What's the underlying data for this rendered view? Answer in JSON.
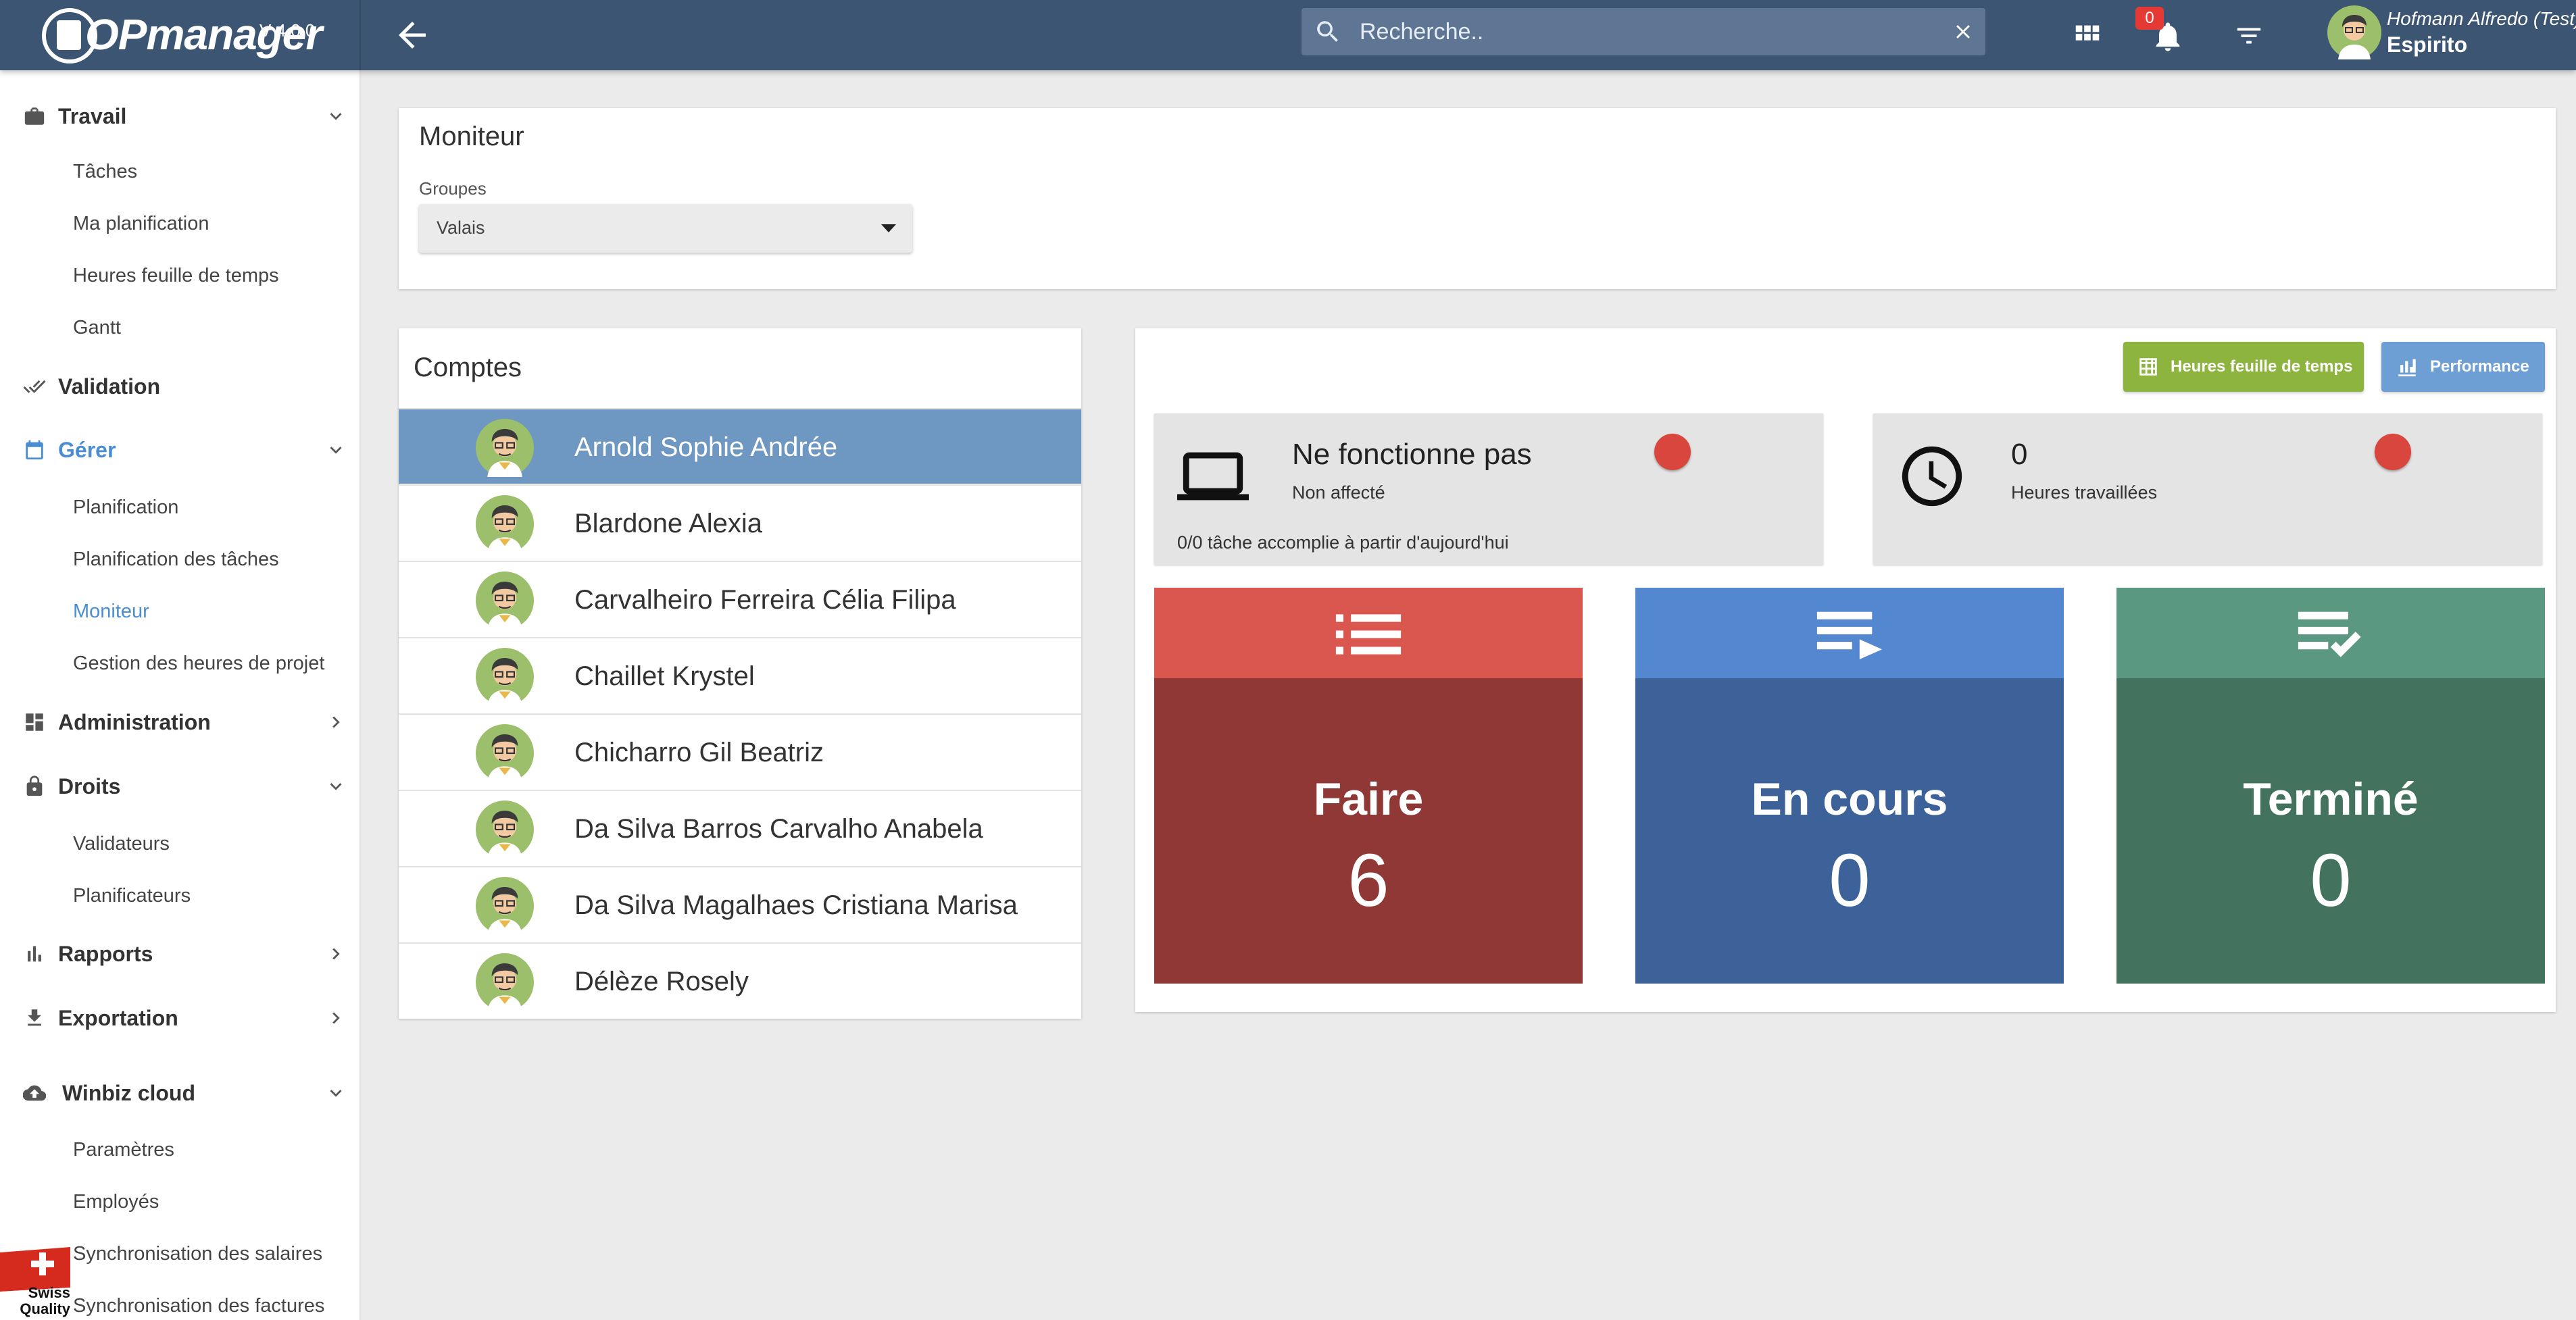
{
  "header": {
    "logo_text": "OPmanager",
    "version": "V 4.0.0",
    "search_placeholder": "Recherche..",
    "notification_count": "0",
    "user_name": "Hofmann Alfredo (Test)",
    "company": "Espirito"
  },
  "sidebar": {
    "sections": [
      {
        "label": "Travail",
        "icon": "briefcase-icon",
        "expanded": true,
        "items": [
          "Tâches",
          "Ma planification",
          "Heures feuille de temps",
          "Gantt"
        ]
      },
      {
        "label": "Validation",
        "icon": "double-check-icon",
        "expanded": false,
        "items": []
      },
      {
        "label": "Gérer",
        "icon": "calendar-icon",
        "expanded": true,
        "active": true,
        "items": [
          "Planification",
          "Planification des tâches",
          "Moniteur",
          "Gestion des heures de projet"
        ],
        "active_item": "Moniteur"
      },
      {
        "label": "Administration",
        "icon": "dashboard-icon",
        "expanded": false,
        "items": []
      },
      {
        "label": "Droits",
        "icon": "lock-icon",
        "expanded": true,
        "items": [
          "Validateurs",
          "Planificateurs"
        ]
      },
      {
        "label": "Rapports",
        "icon": "bar-chart-icon",
        "expanded": false,
        "items": []
      },
      {
        "label": "Exportation",
        "icon": "download-icon",
        "expanded": false,
        "items": []
      },
      {
        "label": "Winbiz cloud",
        "icon": "cloud-icon",
        "expanded": true,
        "items": [
          "Paramètres",
          "Employés",
          "Synchronisation des salaires",
          "Synchronisation des factures"
        ]
      }
    ],
    "badge_text": "Swiss Quality"
  },
  "moniteur": {
    "title": "Moniteur",
    "groupes_label": "Groupes",
    "groupes_value": "Valais"
  },
  "comptes": {
    "title": "Comptes",
    "selected_index": 0,
    "accounts": [
      "Arnold Sophie Andrée",
      "Blardone Alexia",
      "Carvalheiro Ferreira Célia Filipa",
      "Chaillet Krystel",
      "Chicharro Gil Beatriz",
      "Da Silva Barros Carvalho Anabela",
      "Da Silva Magalhaes Cristiana Marisa",
      "Délèze Rosely"
    ]
  },
  "dashboard": {
    "btn_timesheet": "Heures feuille de temps",
    "btn_performance": "Performance",
    "status": {
      "title": "Ne fonctionne pas",
      "subtitle": "Non affecté",
      "footer": "0/0 tâche accomplie à partir d'aujourd'hui",
      "indicator_color": "#d9463e"
    },
    "hours": {
      "value": "0",
      "label": "Heures travaillées",
      "indicator_color": "#d9463e"
    },
    "tiles": [
      {
        "label": "Faire",
        "count": "6",
        "icon": "list-icon",
        "head_color": "#d9574f",
        "body_color": "#8f3835"
      },
      {
        "label": "En cours",
        "count": "0",
        "icon": "playlist-play-icon",
        "head_color": "#5387d0",
        "body_color": "#3d6299"
      },
      {
        "label": "Terminé",
        "count": "0",
        "icon": "playlist-check-icon",
        "head_color": "#5a9882",
        "body_color": "#43735f"
      }
    ]
  }
}
